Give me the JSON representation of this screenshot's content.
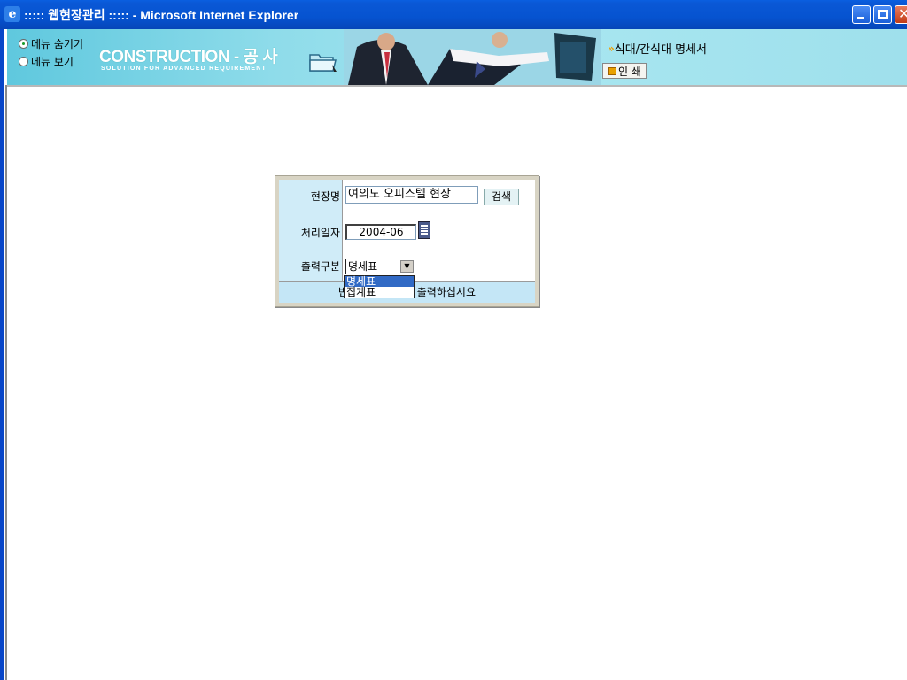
{
  "window": {
    "title": "::::: 웹현장관리 ::::: - Microsoft Internet Explorer",
    "close_glyph": "✕"
  },
  "header": {
    "menu_options": [
      {
        "label": "메뉴 숨기기",
        "selected": true
      },
      {
        "label": "메뉴 보기",
        "selected": false
      }
    ],
    "brand": "CONSTRUCTION - 공 사",
    "brand_sub": "SOLUTION FOR ADVANCED REQUIREMENT",
    "doc_title_arrows": "»",
    "doc_title": "식대/간식대 명세서",
    "print_label": "인 쇄"
  },
  "form": {
    "site_label": "현장명",
    "site_value": "여의도 오피스텔 현장",
    "search_label": "검색",
    "date_label": "처리일자",
    "date_value": "2004-06",
    "output_label": "출력구분",
    "output_selected": "명세표",
    "output_options": [
      "명세표",
      "집계표"
    ],
    "notice": "반드시 조회 후에 출력하십시요"
  }
}
